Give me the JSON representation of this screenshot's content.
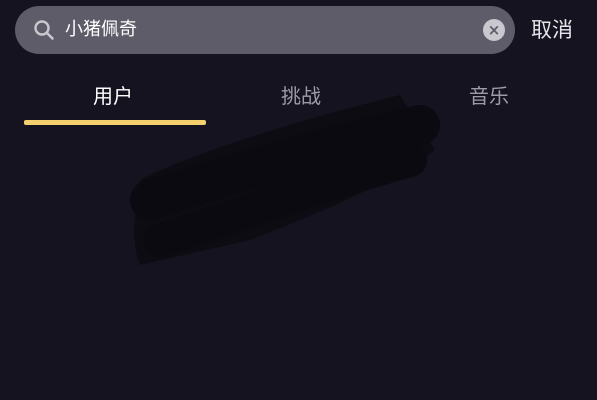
{
  "search": {
    "value": "小猪佩奇",
    "clear_label": "×"
  },
  "cancel_label": "取消",
  "tabs": [
    {
      "label": "用户",
      "active": true
    },
    {
      "label": "挑战",
      "active": false
    },
    {
      "label": "音乐",
      "active": false
    }
  ],
  "colors": {
    "background": "#15131f",
    "search_bar": "#5e5c69",
    "active_tab_indicator": "#f4cf6e",
    "inactive_tab_text": "#9d9ba6"
  },
  "icons": {
    "search": "search-icon",
    "clear": "clear-icon"
  }
}
